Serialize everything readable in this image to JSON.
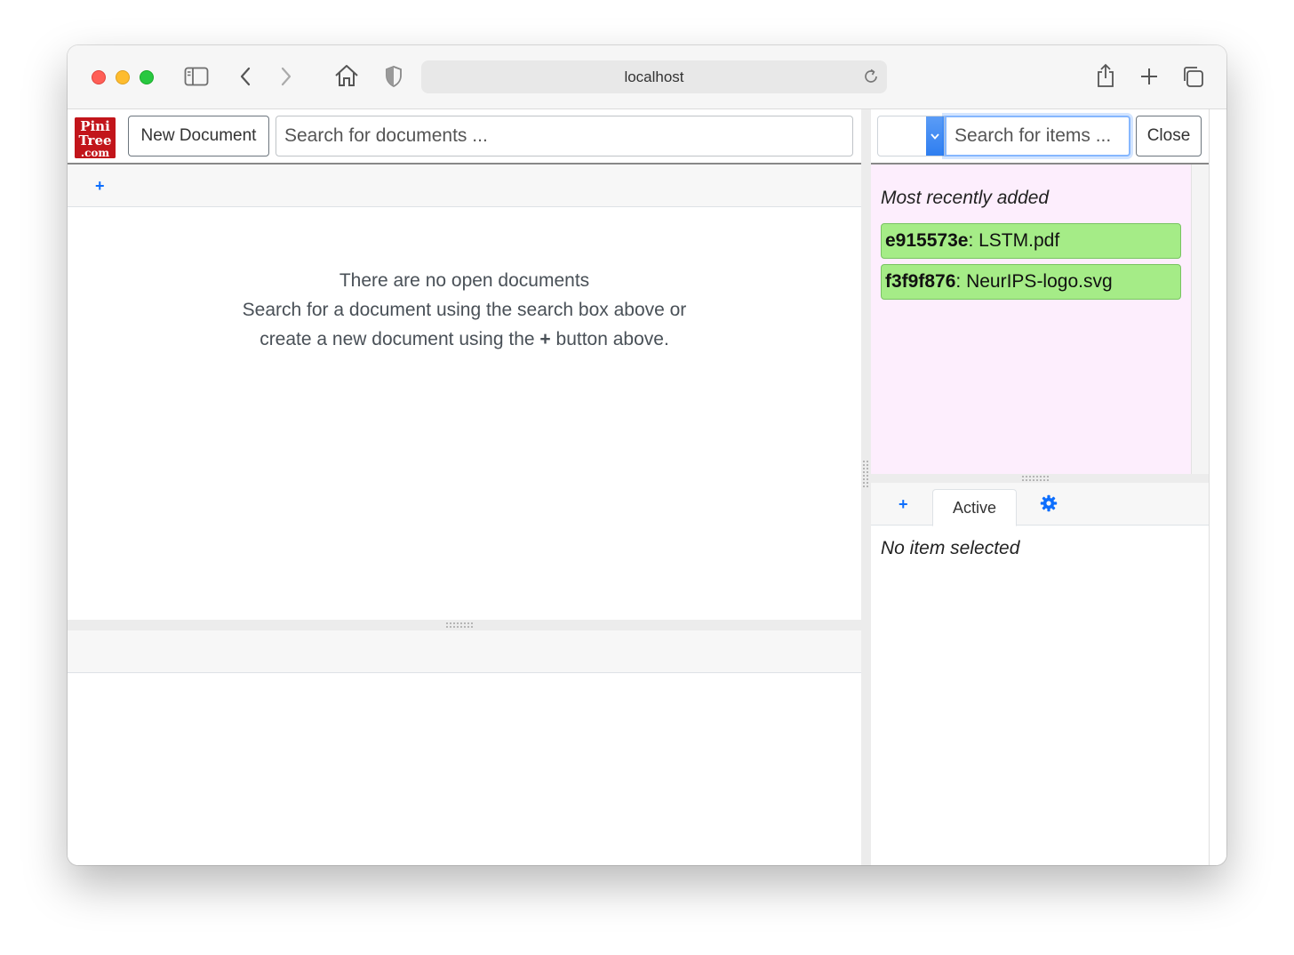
{
  "browser": {
    "url": "localhost",
    "icons": [
      "sidebar-icon",
      "back-icon",
      "forward-icon",
      "home-icon",
      "shield-icon",
      "reload-icon",
      "share-icon",
      "new-tab-icon",
      "tabs-overview-icon"
    ]
  },
  "app": {
    "logo_text": [
      "Pini",
      "Tree",
      ".com"
    ],
    "new_document_label": "New Document",
    "doc_search_placeholder": "Search for documents ...",
    "add_tab_label": "+",
    "empty": {
      "line1": "There are no open documents",
      "line2": "Search for a document using the search box above or",
      "line3_before": "create a new document using the",
      "line3_plus": "+",
      "line3_after": "button above."
    }
  },
  "items_panel": {
    "item_search_placeholder": "Search for items ...",
    "close_label": "Close",
    "recent_title": "Most recently added",
    "recent_items": [
      {
        "id": "e915573e",
        "sep": ":",
        "name": "LSTM.pdf"
      },
      {
        "id": "f3f9f876",
        "sep": ":",
        "name": "NeurIPS-logo.svg"
      }
    ],
    "tabs": {
      "add_label": "+",
      "active_label": "Active",
      "settings_icon": "gear-icon"
    },
    "no_item_text": "No item selected"
  },
  "colors": {
    "accent": "#0d6efd",
    "recent_bg": "#fdeefd",
    "chip_bg": "#a5ec87",
    "logo_bg": "#c2151b"
  }
}
